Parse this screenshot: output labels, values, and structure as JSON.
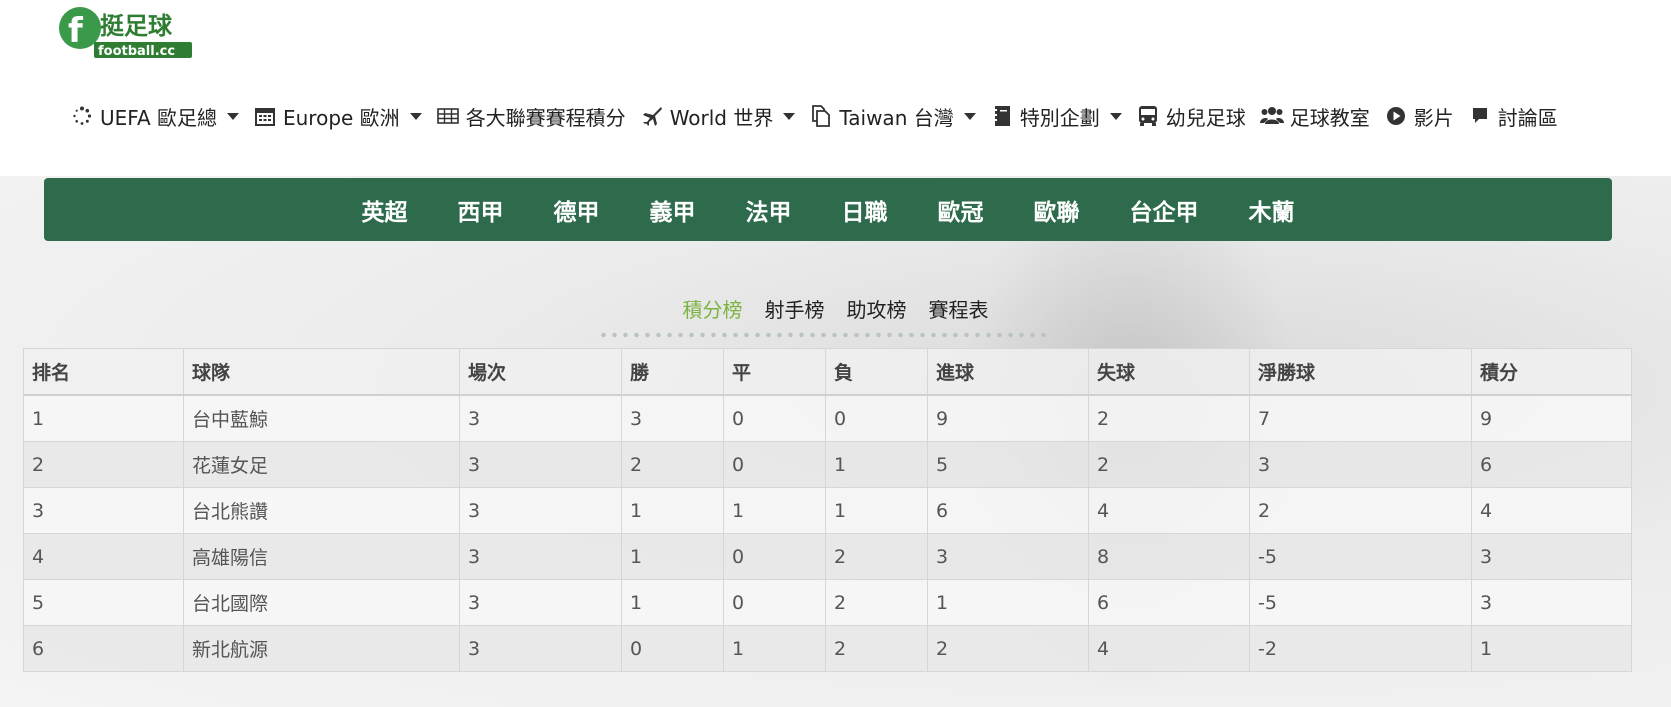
{
  "logo": {
    "letter": "f",
    "chinese": "挺足球",
    "english": "football.cc"
  },
  "nav": [
    {
      "label": "UEFA 歐足總",
      "icon": "spinner-icon",
      "dropdown": true
    },
    {
      "label": "Europe 歐洲",
      "icon": "calendar-icon",
      "dropdown": true
    },
    {
      "label": "各大聯賽賽程積分",
      "icon": "table-icon",
      "dropdown": false
    },
    {
      "label": "World 世界",
      "icon": "plane-icon",
      "dropdown": true
    },
    {
      "label": "Taiwan 台灣",
      "icon": "copy-icon",
      "dropdown": true
    },
    {
      "label": "特別企劃",
      "icon": "book-icon",
      "dropdown": true
    },
    {
      "label": "幼兒足球",
      "icon": "bus-icon",
      "dropdown": false
    },
    {
      "label": "足球教室",
      "icon": "users-icon",
      "dropdown": false
    },
    {
      "label": "影片",
      "icon": "play-circle-icon",
      "dropdown": false
    },
    {
      "label": "討論區",
      "icon": "comment-icon",
      "dropdown": false
    }
  ],
  "leagues": [
    "英超",
    "西甲",
    "德甲",
    "義甲",
    "法甲",
    "日職",
    "歐冠",
    "歐聯",
    "台企甲",
    "木蘭"
  ],
  "subtabs": [
    {
      "label": "積分榜",
      "active": true
    },
    {
      "label": "射手榜",
      "active": false
    },
    {
      "label": "助攻榜",
      "active": false
    },
    {
      "label": "賽程表",
      "active": false
    }
  ],
  "colors": {
    "green_bar": "#2e6b4c",
    "active_tab": "#7cb342"
  },
  "table": {
    "headers": [
      "排名",
      "球隊",
      "場次",
      "勝",
      "平",
      "負",
      "進球",
      "失球",
      "淨勝球",
      "積分"
    ],
    "rows": [
      [
        "1",
        "台中藍鯨",
        "3",
        "3",
        "0",
        "0",
        "9",
        "2",
        "7",
        "9"
      ],
      [
        "2",
        "花蓮女足",
        "3",
        "2",
        "0",
        "1",
        "5",
        "2",
        "3",
        "6"
      ],
      [
        "3",
        "台北熊讚",
        "3",
        "1",
        "1",
        "1",
        "6",
        "4",
        "2",
        "4"
      ],
      [
        "4",
        "高雄陽信",
        "3",
        "1",
        "0",
        "2",
        "3",
        "8",
        "-5",
        "3"
      ],
      [
        "5",
        "台北國際",
        "3",
        "1",
        "0",
        "2",
        "1",
        "6",
        "-5",
        "3"
      ],
      [
        "6",
        "新北航源",
        "3",
        "0",
        "1",
        "2",
        "2",
        "4",
        "-2",
        "1"
      ]
    ]
  }
}
